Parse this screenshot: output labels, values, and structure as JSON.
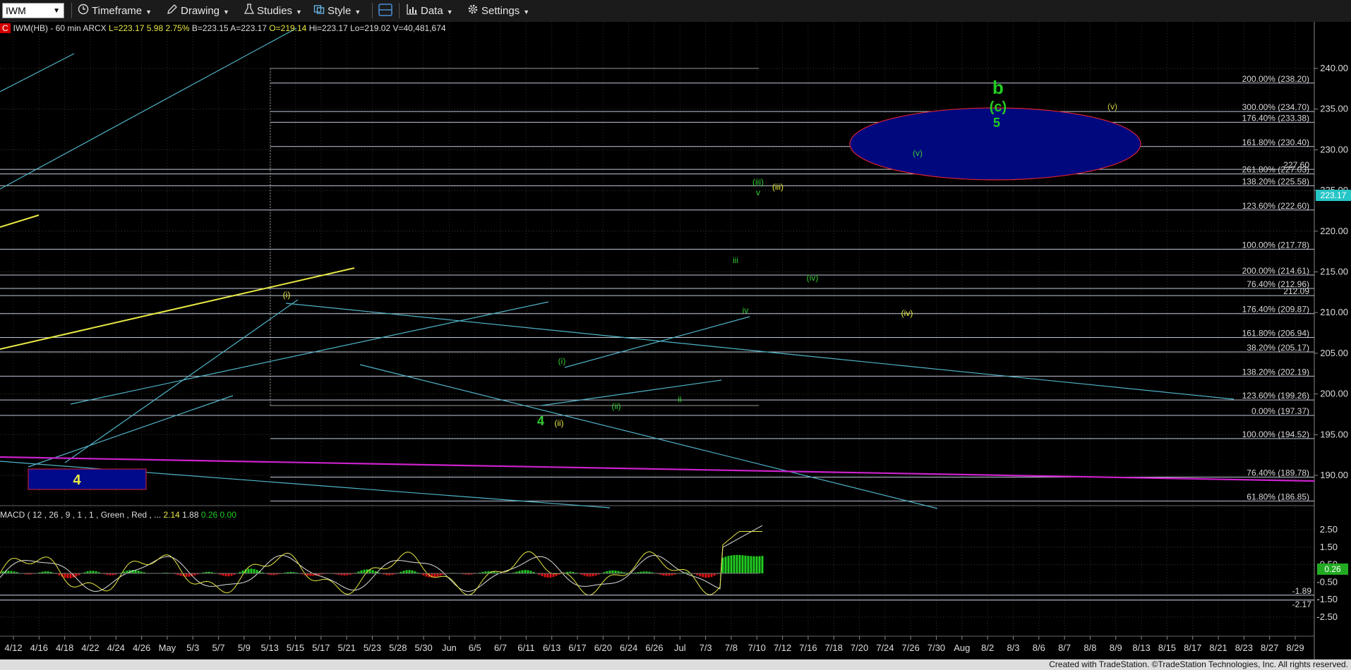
{
  "toolbar": {
    "symbol": "IWM",
    "timeframe": "Timeframe",
    "drawing": "Drawing",
    "studies": "Studies",
    "style": "Style",
    "data": "Data",
    "settings": "Settings"
  },
  "legend": {
    "badge": "C",
    "text": "IWM(HB) - 60 min  ARCX",
    "last": "L=223.17",
    "change": "5.98",
    "pct": "2.75%",
    "bid": "B=223.15",
    "ask": "A=223.17",
    "open": "O=219.14",
    "high": "Hi=223.17",
    "low": "Lo=219.02",
    "volume": "V=40,481,674"
  },
  "macd_legend": {
    "text": "MACD ( 12 , 26 , 9 , 1 , 1 , Green , Red , ...",
    "v1": "2.14",
    "v2": "1.88",
    "v3": "0.26",
    "v4": "0.00"
  },
  "price_axis": [
    "240.00",
    "235.00",
    "230.00",
    "225.00",
    "220.00",
    "215.00",
    "210.00",
    "205.00",
    "200.00",
    "195.00",
    "190.00"
  ],
  "price_axis_values": [
    240,
    235,
    230,
    225,
    220,
    215,
    210,
    205,
    200,
    195,
    190
  ],
  "current_price": "223.17",
  "macd_axis": [
    "2.50",
    "1.50",
    "0.50",
    "-0.50",
    "-1.50",
    "-2.50"
  ],
  "macd_axis_values": [
    2.5,
    1.5,
    0.5,
    -0.5,
    -1.5,
    -2.5
  ],
  "macd_current": "0.26",
  "macd_levels": [
    "-1.89",
    "-2.17"
  ],
  "date_axis": [
    "4/12",
    "4/16",
    "4/18",
    "4/22",
    "4/24",
    "4/26",
    "May",
    "5/3",
    "5/7",
    "5/9",
    "5/13",
    "5/15",
    "5/17",
    "5/21",
    "5/23",
    "5/28",
    "5/30",
    "Jun",
    "6/5",
    "6/7",
    "6/11",
    "6/13",
    "6/17",
    "6/20",
    "6/24",
    "6/26",
    "Jul",
    "7/3",
    "7/8",
    "7/10",
    "7/12",
    "7/16",
    "7/18",
    "7/20",
    "7/24",
    "7/26",
    "7/30",
    "Aug",
    "8/2",
    "8/3",
    "8/6",
    "8/7",
    "8/8",
    "8/9",
    "8/13",
    "8/15",
    "8/17",
    "8/21",
    "8/23",
    "8/27",
    "8/29"
  ],
  "fib_levels": [
    {
      "label": "200.00% (238.20)",
      "price": 238.2
    },
    {
      "label": "300.00% (234.70)",
      "price": 234.7
    },
    {
      "label": "176.40% (233.38)",
      "price": 233.38
    },
    {
      "label": "161.80% (230.40)",
      "price": 230.4
    },
    {
      "label": "227.60",
      "price": 227.6
    },
    {
      "label": "261.80% (227.03)",
      "price": 227.03
    },
    {
      "label": "138.20% (225.58)",
      "price": 225.58
    },
    {
      "label": "123.60% (222.60)",
      "price": 222.6
    },
    {
      "label": "100.00% (217.78)",
      "price": 217.78
    },
    {
      "label": "200.00% (214.61)",
      "price": 214.61
    },
    {
      "label": "76.40% (212.96)",
      "price": 212.96
    },
    {
      "label": "212.09",
      "price": 212.09
    },
    {
      "label": "176.40% (209.87)",
      "price": 209.87
    },
    {
      "label": "161.80% (206.94)",
      "price": 206.94
    },
    {
      "label": "38.20% (205.17)",
      "price": 205.17
    },
    {
      "label": "138.20% (202.19)",
      "price": 202.19
    },
    {
      "label": "123.60% (199.26)",
      "price": 199.26
    },
    {
      "label": "0.00% (197.37)",
      "price": 197.37
    },
    {
      "label": "100.00% (194.52)",
      "price": 194.52
    },
    {
      "label": "76.40% (189.78)",
      "price": 189.78
    },
    {
      "label": "61.80% (186.85)",
      "price": 186.85
    }
  ],
  "wave_labels": [
    {
      "text": "b",
      "color": "#22cc22"
    },
    {
      "text": "(c)",
      "color": "#22cc22"
    },
    {
      "text": "5",
      "color": "#22cc22"
    },
    {
      "text": "(v)",
      "color": "#cccc44"
    },
    {
      "text": "(v)",
      "color": "#33cc33"
    },
    {
      "text": "(iii)",
      "color": "#33cc33"
    },
    {
      "text": "v",
      "color": "#33cc33"
    },
    {
      "text": "(iii)",
      "color": "#e8e844"
    },
    {
      "text": "iii",
      "color": "#33cc33"
    },
    {
      "text": "(iv)",
      "color": "#33cc33"
    },
    {
      "text": "iv",
      "color": "#33cc33"
    },
    {
      "text": "(iv)",
      "color": "#e8e844"
    },
    {
      "text": "(i)",
      "color": "#e8e844"
    },
    {
      "text": "(i)",
      "color": "#33cc33"
    },
    {
      "text": "4",
      "color": "#33cc33"
    },
    {
      "text": "(ii)",
      "color": "#e8e844"
    },
    {
      "text": "(ii)",
      "color": "#33cc33"
    },
    {
      "text": "ii",
      "color": "#33cc33"
    },
    {
      "text": "4",
      "color": "#e8e844"
    }
  ],
  "footer": "Created with TradeStation. ©TradeStation Technologies, Inc. All rights reserved.",
  "colors": {
    "background": "#000000",
    "grid": "#3a3a3a",
    "fib": "#c0c8d8",
    "trend": "#4fb3c8",
    "yellow": "#e8e844",
    "magenta": "#cc22cc",
    "target": "#000a8a",
    "price_box": "#27c6c6",
    "up": "#22cc22",
    "down": "#dd1111"
  }
}
